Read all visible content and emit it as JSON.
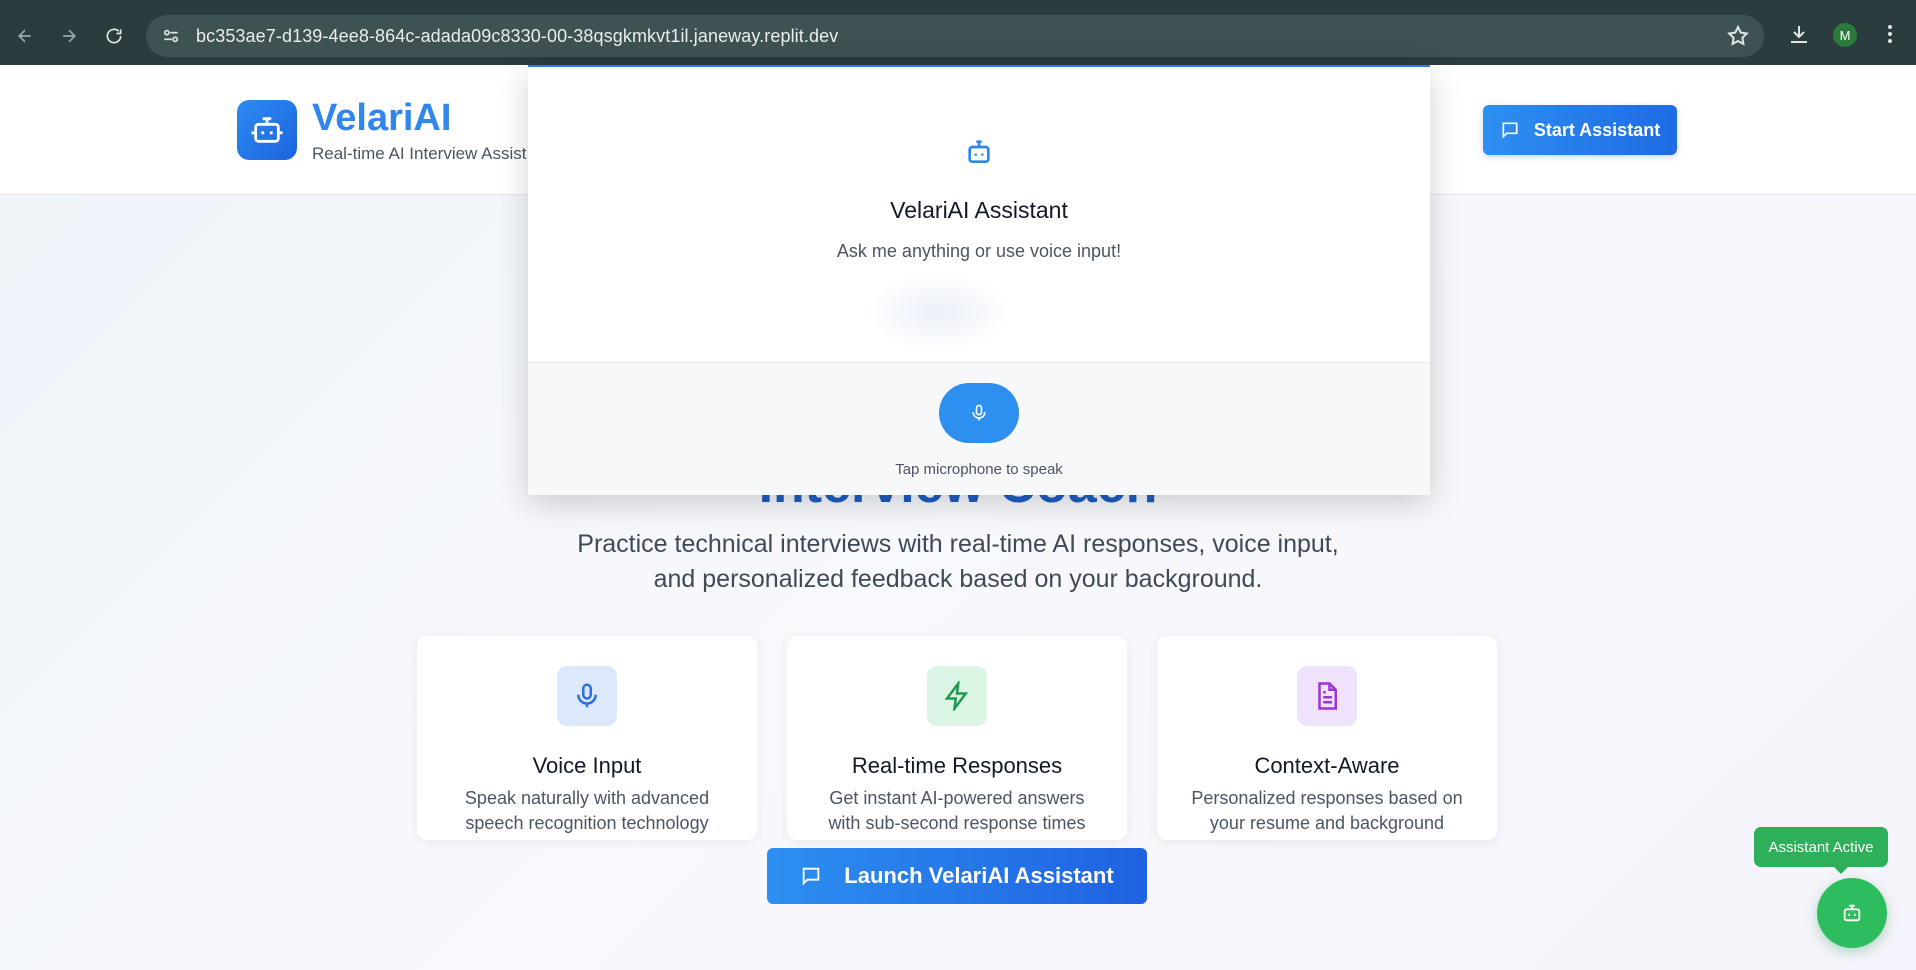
{
  "browser": {
    "url": "bc353ae7-d139-4ee8-864c-adada09c8330-00-38qsgkmkvt1il.janeway.replit.dev",
    "profile_initial": "M"
  },
  "header": {
    "brand": "VelariAI",
    "tagline": "Real-time AI Interview Assist",
    "start_button": "Start Assistant"
  },
  "hero": {
    "title_partial": "Interview Coach",
    "description": "Practice technical interviews with real-time AI responses, voice input, and personalized feedback based on your background."
  },
  "features": [
    {
      "title": "Voice Input",
      "description": "Speak naturally with advanced speech recognition technology",
      "icon": "mic-icon",
      "color": "#2f6fe0",
      "bg": "#dce9fc"
    },
    {
      "title": "Real-time Responses",
      "description": "Get instant AI-powered answers with sub-second response times",
      "icon": "zap-icon",
      "color": "#1f9a4a",
      "bg": "#daf5e3"
    },
    {
      "title": "Context-Aware",
      "description": "Personalized responses based on your resume and background",
      "icon": "document-icon",
      "color": "#9b35d6",
      "bg": "#f1e2fb"
    }
  ],
  "launch_button": "Launch VelariAI Assistant",
  "assistant_badge": "Assistant Active",
  "modal": {
    "title": "VelariAI Assistant",
    "subtitle": "Ask me anything or use voice input!",
    "mic_hint": "Tap microphone to speak"
  },
  "colors": {
    "brand_blue": "#2f86ee",
    "active_green": "#2ebd5e"
  }
}
